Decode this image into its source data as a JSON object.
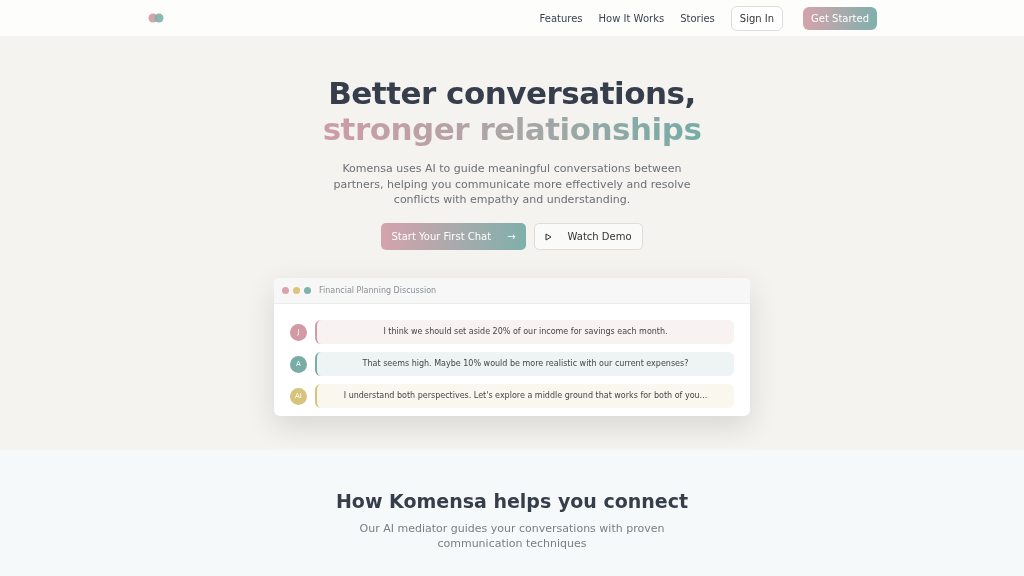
{
  "nav": {
    "links": [
      "Features",
      "How It Works",
      "Stories"
    ],
    "sign_in": "Sign In",
    "cta": "Get Started"
  },
  "hero": {
    "title_line1": "Better conversations,",
    "title_line2": "stronger relationships",
    "description": "Komensa uses AI to guide meaningful conversations between partners, helping you communicate more effectively and resolve conflicts with empathy and understanding.",
    "primary_button": "Start Your First Chat",
    "primary_arrow": "→",
    "secondary_button": "Watch Demo"
  },
  "chat_window": {
    "title": "Financial Planning Discussion",
    "dots": [
      {
        "color": "#d8a4ac"
      },
      {
        "color": "#dcc57a"
      },
      {
        "color": "#7fb3ae"
      }
    ],
    "messages": [
      {
        "initial": "J",
        "color": "#d19aa4",
        "text": "I think we should set aside 20% of our income for savings each month."
      },
      {
        "initial": "A",
        "color": "#7aaca7",
        "text": "That seems high. Maybe 10% would be more realistic with our current expenses?"
      },
      {
        "initial": "AI",
        "color": "#d8c37c",
        "text": "I understand both perspectives. Let's explore a middle ground that works for both of you..."
      }
    ]
  },
  "features": {
    "title": "How Komensa helps you connect",
    "subtitle": "Our AI mediator guides your conversations with proven communication techniques"
  }
}
